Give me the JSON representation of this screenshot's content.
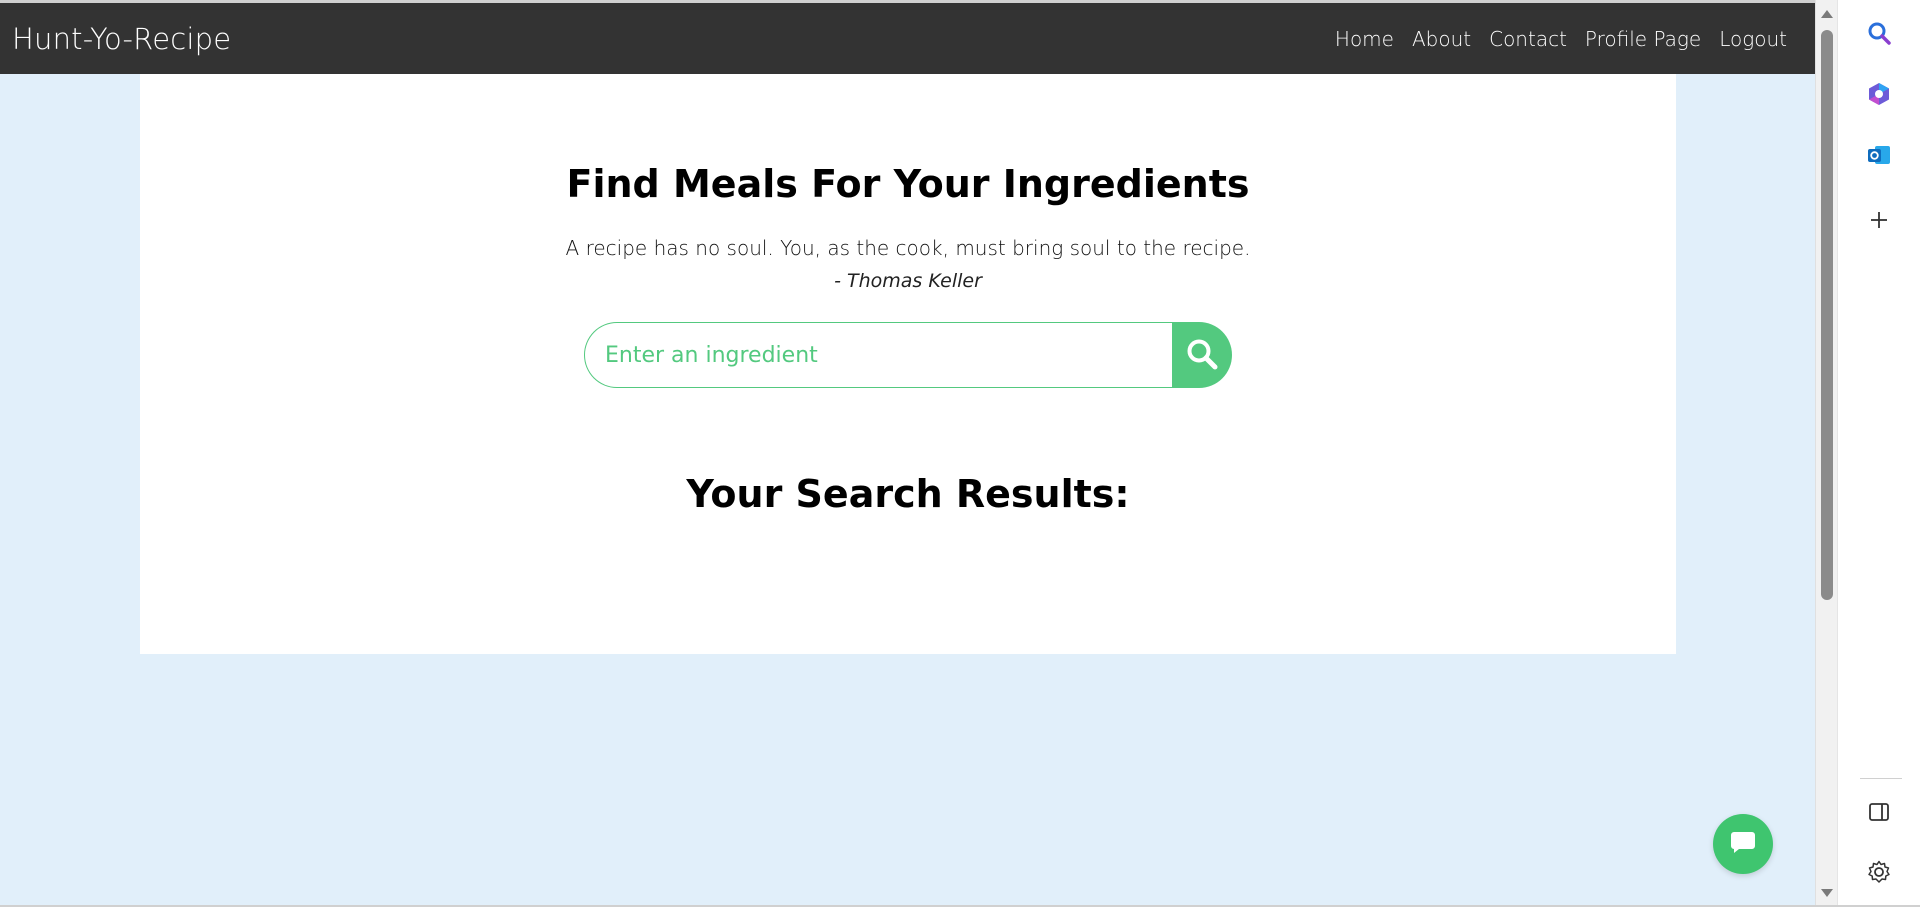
{
  "navbar": {
    "brand": "Hunt-Yo-Recipe",
    "links": [
      "Home",
      "About",
      "Contact",
      "Profile Page",
      "Logout"
    ]
  },
  "main": {
    "title": "Find Meals For Your Ingredients",
    "quote": "A recipe has no soul. You, as the cook, must bring soul to the recipe.",
    "quote_author": "- Thomas Keller",
    "search": {
      "placeholder": "Enter an ingredient",
      "value": ""
    },
    "results_heading": "Your Search Results:"
  },
  "chat_button": {
    "icon": "chat-bubble-icon"
  },
  "browser_sidebar": {
    "icons": [
      "search-icon",
      "copilot-icon",
      "outlook-icon",
      "add-icon",
      "sidebar-toggle-icon",
      "settings-icon"
    ]
  },
  "colors": {
    "navbar_bg": "#333333",
    "page_bg": "#e1effa",
    "accent_green": "#53c97f",
    "card_bg": "#ffffff"
  }
}
